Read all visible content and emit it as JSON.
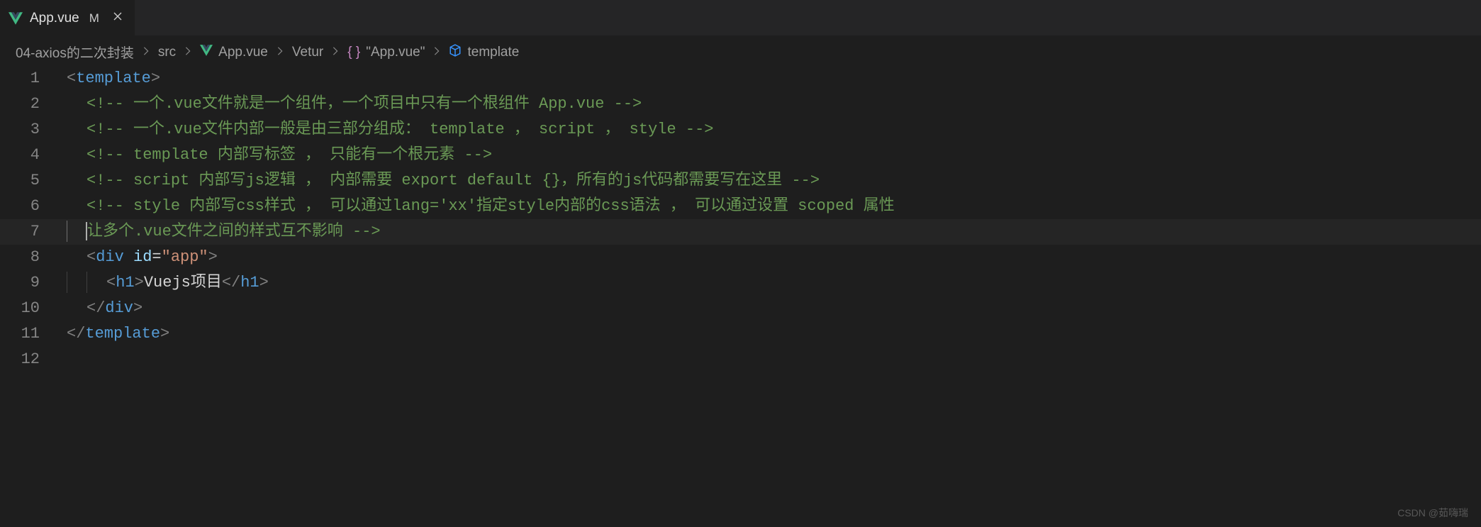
{
  "tab": {
    "filename": "App.vue",
    "modified_badge": "M"
  },
  "breadcrumb": {
    "items": [
      {
        "label": "04-axios的二次封装"
      },
      {
        "label": "src"
      },
      {
        "label": "App.vue",
        "icon": "vue"
      },
      {
        "label": "Vetur"
      },
      {
        "label": "\"App.vue\"",
        "icon": "braces"
      },
      {
        "label": "template",
        "icon": "cube"
      }
    ]
  },
  "editor": {
    "lines": [
      {
        "n": 1,
        "marker": "",
        "indent": 0,
        "tokens": [
          {
            "t": "<",
            "c": "punct"
          },
          {
            "t": "template",
            "c": "tag"
          },
          {
            "t": ">",
            "c": "punct"
          }
        ]
      },
      {
        "n": 2,
        "marker": "changed",
        "indent": 1,
        "tokens": [
          {
            "t": "<!-- 一个.vue文件就是一个组件，一个项目中只有一个根组件 App.vue -->",
            "c": "cmt"
          }
        ]
      },
      {
        "n": 3,
        "marker": "changed",
        "indent": 1,
        "tokens": [
          {
            "t": "<!-- 一个.vue文件内部一般是由三部分组成： template ， script ， style -->",
            "c": "cmt"
          }
        ]
      },
      {
        "n": 4,
        "marker": "changed",
        "indent": 1,
        "tokens": [
          {
            "t": "<!-- template 内部写标签 ， 只能有一个根元素 -->",
            "c": "cmt"
          }
        ]
      },
      {
        "n": 5,
        "marker": "changed",
        "indent": 1,
        "tokens": [
          {
            "t": "<!-- script 内部写js逻辑 ， 内部需要 export default {}，所有的js代码都需要写在这里 -->",
            "c": "cmt"
          }
        ]
      },
      {
        "n": 6,
        "marker": "changed",
        "indent": 1,
        "tokens": [
          {
            "t": "<!-- style 内部写css样式 ， 可以通过lang='xx'指定style内部的css语法 ， 可以通过设置 scoped 属性",
            "c": "cmt"
          }
        ]
      },
      {
        "n": 7,
        "marker": "changed",
        "indent": 1,
        "guide": true,
        "active": true,
        "cursor": true,
        "tokens": [
          {
            "t": "让多个.vue文件之间的样式互不影响 -->",
            "c": "cmt"
          }
        ]
      },
      {
        "n": 8,
        "marker": "",
        "indent": 1,
        "tokens": [
          {
            "t": "<",
            "c": "punct"
          },
          {
            "t": "div",
            "c": "tag"
          },
          {
            "t": " ",
            "c": "txt"
          },
          {
            "t": "id",
            "c": "attr"
          },
          {
            "t": "=",
            "c": "txt"
          },
          {
            "t": "\"app\"",
            "c": "str"
          },
          {
            "t": ">",
            "c": "punct"
          }
        ]
      },
      {
        "n": 9,
        "marker": "modified",
        "indent": 2,
        "guide": true,
        "tokens": [
          {
            "t": "<",
            "c": "punct"
          },
          {
            "t": "h1",
            "c": "tag"
          },
          {
            "t": ">",
            "c": "punct"
          },
          {
            "t": "Vuejs项目",
            "c": "txt"
          },
          {
            "t": "</",
            "c": "punct"
          },
          {
            "t": "h1",
            "c": "tag"
          },
          {
            "t": ">",
            "c": "punct"
          }
        ]
      },
      {
        "n": 10,
        "marker": "",
        "indent": 1,
        "tokens": [
          {
            "t": "</",
            "c": "punct"
          },
          {
            "t": "div",
            "c": "tag"
          },
          {
            "t": ">",
            "c": "punct"
          }
        ]
      },
      {
        "n": 11,
        "marker": "",
        "indent": 0,
        "tokens": [
          {
            "t": "</",
            "c": "punct"
          },
          {
            "t": "template",
            "c": "tag"
          },
          {
            "t": ">",
            "c": "punct"
          }
        ]
      },
      {
        "n": 12,
        "marker": "",
        "indent": 0,
        "tokens": []
      }
    ]
  },
  "watermark": "CSDN @茹嗨瑞"
}
